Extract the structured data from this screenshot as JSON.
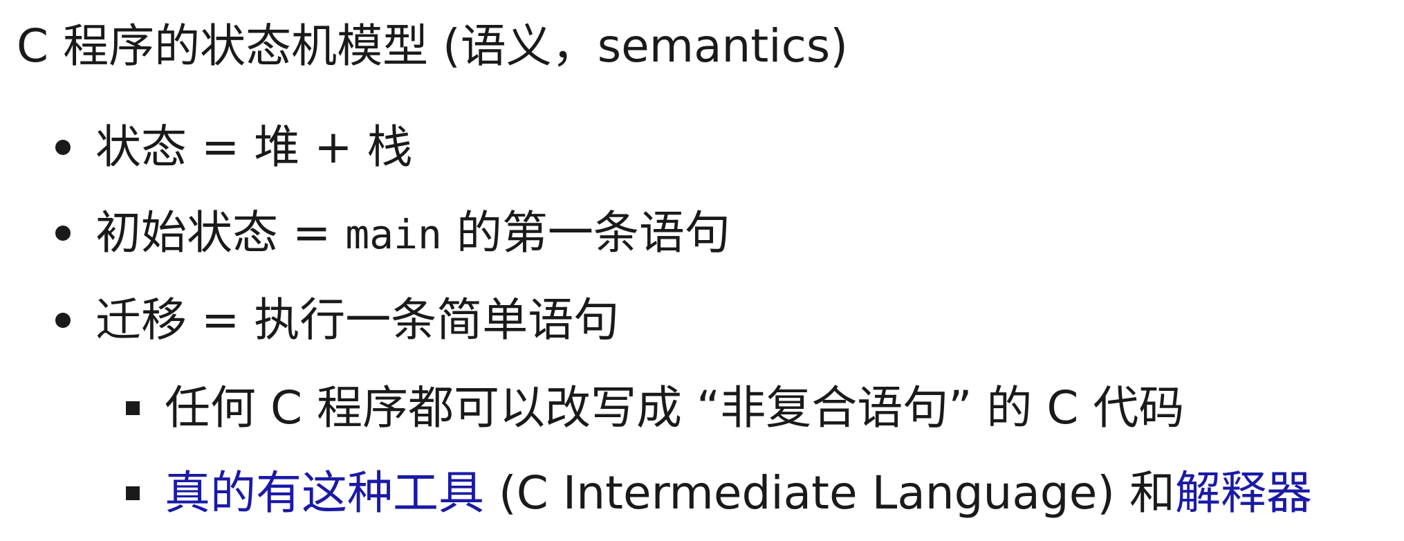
{
  "title": "C 程序的状态机模型 (语义，semantics)",
  "bullets": [
    {
      "text": "状态 = 堆 + 栈"
    },
    {
      "text_before": "初始状态 = ",
      "code": "main",
      "text_after": " 的第一条语句"
    },
    {
      "text": "迁移 = 执行一条简单语句"
    }
  ],
  "subbullets": [
    {
      "text": "任何 C 程序都可以改写成 “非复合语句” 的 C 代码"
    },
    {
      "link1": "真的有这种工具",
      "middle": " (C Intermediate Language) 和",
      "link2": "解释器"
    }
  ],
  "colors": {
    "text": "#1a1a1a",
    "link": "#1a1aa6",
    "background": "#ffffff"
  }
}
